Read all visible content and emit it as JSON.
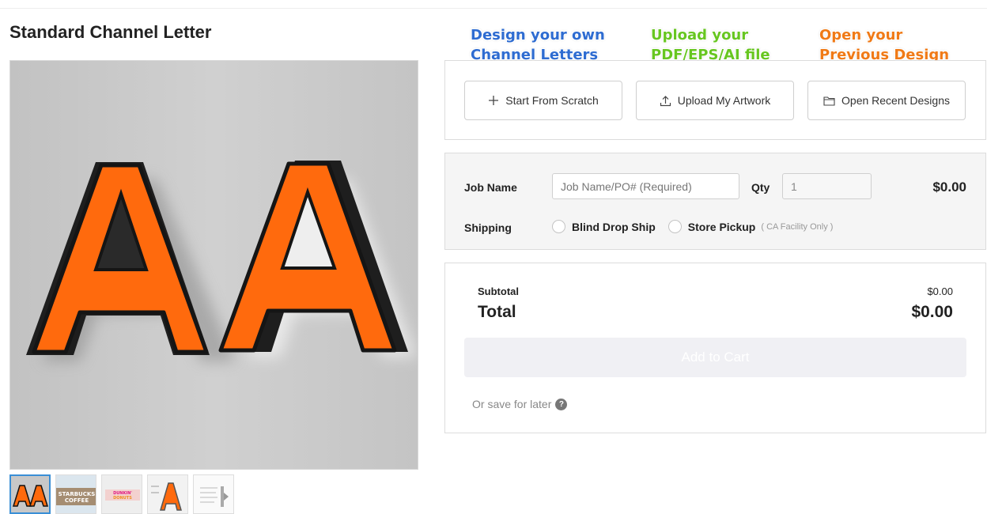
{
  "product": {
    "title": "Standard Channel Letter"
  },
  "gallery": {
    "main_image_alt": "AA",
    "thumbnails": [
      {
        "name": "thumb-aa-letters",
        "text": "AA"
      },
      {
        "name": "thumb-starbucks",
        "text": "STARBUCKS COFFEE"
      },
      {
        "name": "thumb-dunkin",
        "text": "DUNKIN' DONUTS"
      },
      {
        "name": "thumb-letter-a",
        "text": "A"
      },
      {
        "name": "thumb-spec-sheet",
        "text": ""
      }
    ]
  },
  "annotations": {
    "design_line1": "Design your own",
    "design_line2": "Channel Letters",
    "upload_line1": "Upload your",
    "upload_line2": "PDF/EPS/AI file",
    "open_line1": "Open your",
    "open_line2": "Previous Design",
    "colors": {
      "design": "#2e6cd1",
      "upload": "#67c620",
      "open": "#f07a16"
    }
  },
  "actions": {
    "start_scratch": "Start From Scratch",
    "upload_artwork": "Upload My Artwork",
    "open_recent": "Open Recent Designs"
  },
  "job": {
    "job_name_label": "Job Name",
    "job_name_placeholder": "Job Name/PO# (Required)",
    "qty_label": "Qty",
    "qty_value": "1",
    "price": "$0.00",
    "shipping_label": "Shipping",
    "shipping_options": [
      "Blind Drop Ship",
      "Store Pickup"
    ],
    "shipping_note": "( CA Facility Only )"
  },
  "totals": {
    "subtotal_label": "Subtotal",
    "subtotal_value": "$0.00",
    "total_label": "Total",
    "total_value": "$0.00",
    "add_to_cart": "Add to Cart",
    "save_later": "Or save for later"
  }
}
